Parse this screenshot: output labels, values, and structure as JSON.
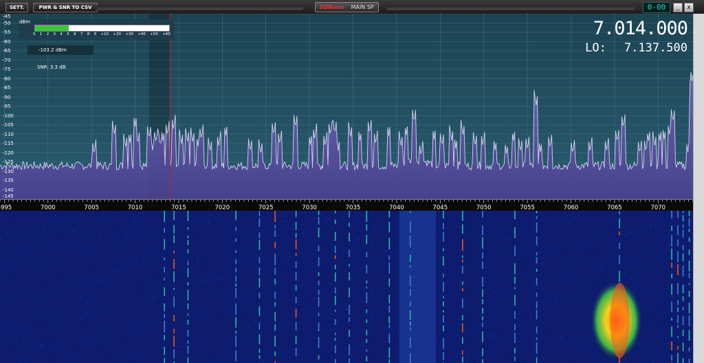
{
  "toolbar": {
    "sett_label": "SETT.",
    "csv_label": "PWR & SNR TO CSV",
    "brand": "SDRuno",
    "window_title": "MAIN SP",
    "clock": "0-00",
    "minimize_label": "_",
    "close_label": "x"
  },
  "readout": {
    "frequency": "7.014.000",
    "lo_label": "LO:",
    "lo_value": "7.137.500",
    "signal_dbm": "-103.2 dBm",
    "snr": "SNR: 3.3 dB",
    "meter_unit": "dBm",
    "meter_level": 0.25,
    "meter_scale": [
      "S",
      "1",
      "2",
      "3",
      "4",
      "5",
      "6",
      "7",
      "8",
      "9",
      "+10",
      "+20",
      "+30",
      "+40",
      "+50",
      "+60"
    ]
  },
  "chart_data": {
    "type": "line",
    "x_min": 6994.5,
    "x_max": 7074,
    "y_min": -145,
    "y_max": -45,
    "y_ticks": [
      -45,
      -50,
      -55,
      -60,
      -65,
      -70,
      -75,
      -80,
      -85,
      -90,
      -95,
      -100,
      -105,
      -110,
      -115,
      -120,
      -125,
      -130,
      -135,
      -140,
      -145
    ],
    "x_ticks": [
      6995,
      7000,
      7005,
      7010,
      7015,
      7020,
      7025,
      7030,
      7035,
      7040,
      7045,
      7050,
      7055,
      7060,
      7065,
      7070
    ],
    "noise_floor": -127,
    "tuned_frequency": 7014.0,
    "peaks": [
      [
        7005.3,
        -121
      ],
      [
        7007.6,
        -111
      ],
      [
        7008.9,
        -118
      ],
      [
        7009.4,
        -115
      ],
      [
        7010.0,
        -106
      ],
      [
        7010.3,
        -116
      ],
      [
        7011.6,
        -113
      ],
      [
        7012.0,
        -119
      ],
      [
        7012.4,
        -115
      ],
      [
        7012.9,
        -117
      ],
      [
        7013.2,
        -114
      ],
      [
        7013.7,
        -111
      ],
      [
        7014.4,
        -108
      ],
      [
        7015.3,
        -116
      ],
      [
        7016.0,
        -115
      ],
      [
        7016.6,
        -115
      ],
      [
        7017.2,
        -117
      ],
      [
        7017.6,
        -113
      ],
      [
        7018.6,
        -120
      ],
      [
        7019.6,
        -117
      ],
      [
        7020.4,
        -111
      ],
      [
        7023.2,
        -120
      ],
      [
        7024.4,
        -121
      ],
      [
        7025.9,
        -111
      ],
      [
        7026.6,
        -116
      ],
      [
        7028.4,
        -107
      ],
      [
        7030.1,
        -116
      ],
      [
        7030.6,
        -113
      ],
      [
        7031.8,
        -117
      ],
      [
        7032.4,
        -111
      ],
      [
        7032.9,
        -110
      ],
      [
        7033.3,
        -119
      ],
      [
        7034.7,
        -112
      ],
      [
        7035.8,
        -114
      ],
      [
        7036.9,
        -110
      ],
      [
        7037.6,
        -116
      ],
      [
        7039.1,
        -111
      ],
      [
        7040.5,
        -117
      ],
      [
        7041.1,
        -111
      ],
      [
        7042.0,
        -104
      ],
      [
        7042.8,
        -122
      ],
      [
        7044.3,
        -113
      ],
      [
        7045.2,
        -117
      ],
      [
        7046.3,
        -114
      ],
      [
        7046.8,
        -118
      ],
      [
        7047.6,
        -111
      ],
      [
        7049.0,
        -117
      ],
      [
        7049.9,
        -117
      ],
      [
        7051.3,
        -119
      ],
      [
        7052.6,
        -121
      ],
      [
        7053.4,
        -114
      ],
      [
        7054.2,
        -120
      ],
      [
        7055.0,
        -119
      ],
      [
        7056.0,
        -95
      ],
      [
        7056.5,
        -120
      ],
      [
        7057.6,
        -118
      ],
      [
        7060.2,
        -121
      ],
      [
        7062.2,
        -120
      ],
      [
        7064.1,
        -120
      ],
      [
        7065.3,
        -115
      ],
      [
        7066.0,
        -107
      ],
      [
        7067.9,
        -121
      ],
      [
        7068.6,
        -120
      ],
      [
        7068.9,
        -114
      ],
      [
        7069.6,
        -117
      ],
      [
        7070.2,
        -114
      ],
      [
        7070.7,
        -113
      ],
      [
        7071.3,
        -111
      ],
      [
        7071.7,
        -104
      ],
      [
        7073.4,
        -120
      ],
      [
        7073.8,
        -90
      ],
      [
        7073.9,
        -82
      ]
    ],
    "waterfall_traces": [
      {
        "f": 7013.3,
        "hot": false
      },
      {
        "f": 7014.4,
        "hot": true
      },
      {
        "f": 7016.0,
        "hot": false
      },
      {
        "f": 7021.5,
        "hot": false
      },
      {
        "f": 7024.2,
        "hot": false
      },
      {
        "f": 7026.0,
        "hot": true
      },
      {
        "f": 7028.4,
        "hot": true
      },
      {
        "f": 7031.0,
        "hot": false
      },
      {
        "f": 7032.9,
        "hot": true
      },
      {
        "f": 7034.5,
        "hot": false
      },
      {
        "f": 7036.5,
        "hot": false
      },
      {
        "f": 7039.1,
        "hot": false
      },
      {
        "f": 7041.5,
        "hot": false
      },
      {
        "f": 7045.3,
        "hot": false
      },
      {
        "f": 7047.5,
        "hot": true
      },
      {
        "f": 7049.8,
        "hot": false
      },
      {
        "f": 7053.5,
        "hot": false
      },
      {
        "f": 7056.0,
        "hot": false
      },
      {
        "f": 7065.5,
        "hot": true
      },
      {
        "f": 7071.5,
        "hot": true
      },
      {
        "f": 7072.2,
        "hot": true
      },
      {
        "f": 7072.8,
        "hot": false
      },
      {
        "f": 7073.5,
        "hot": false
      }
    ]
  }
}
